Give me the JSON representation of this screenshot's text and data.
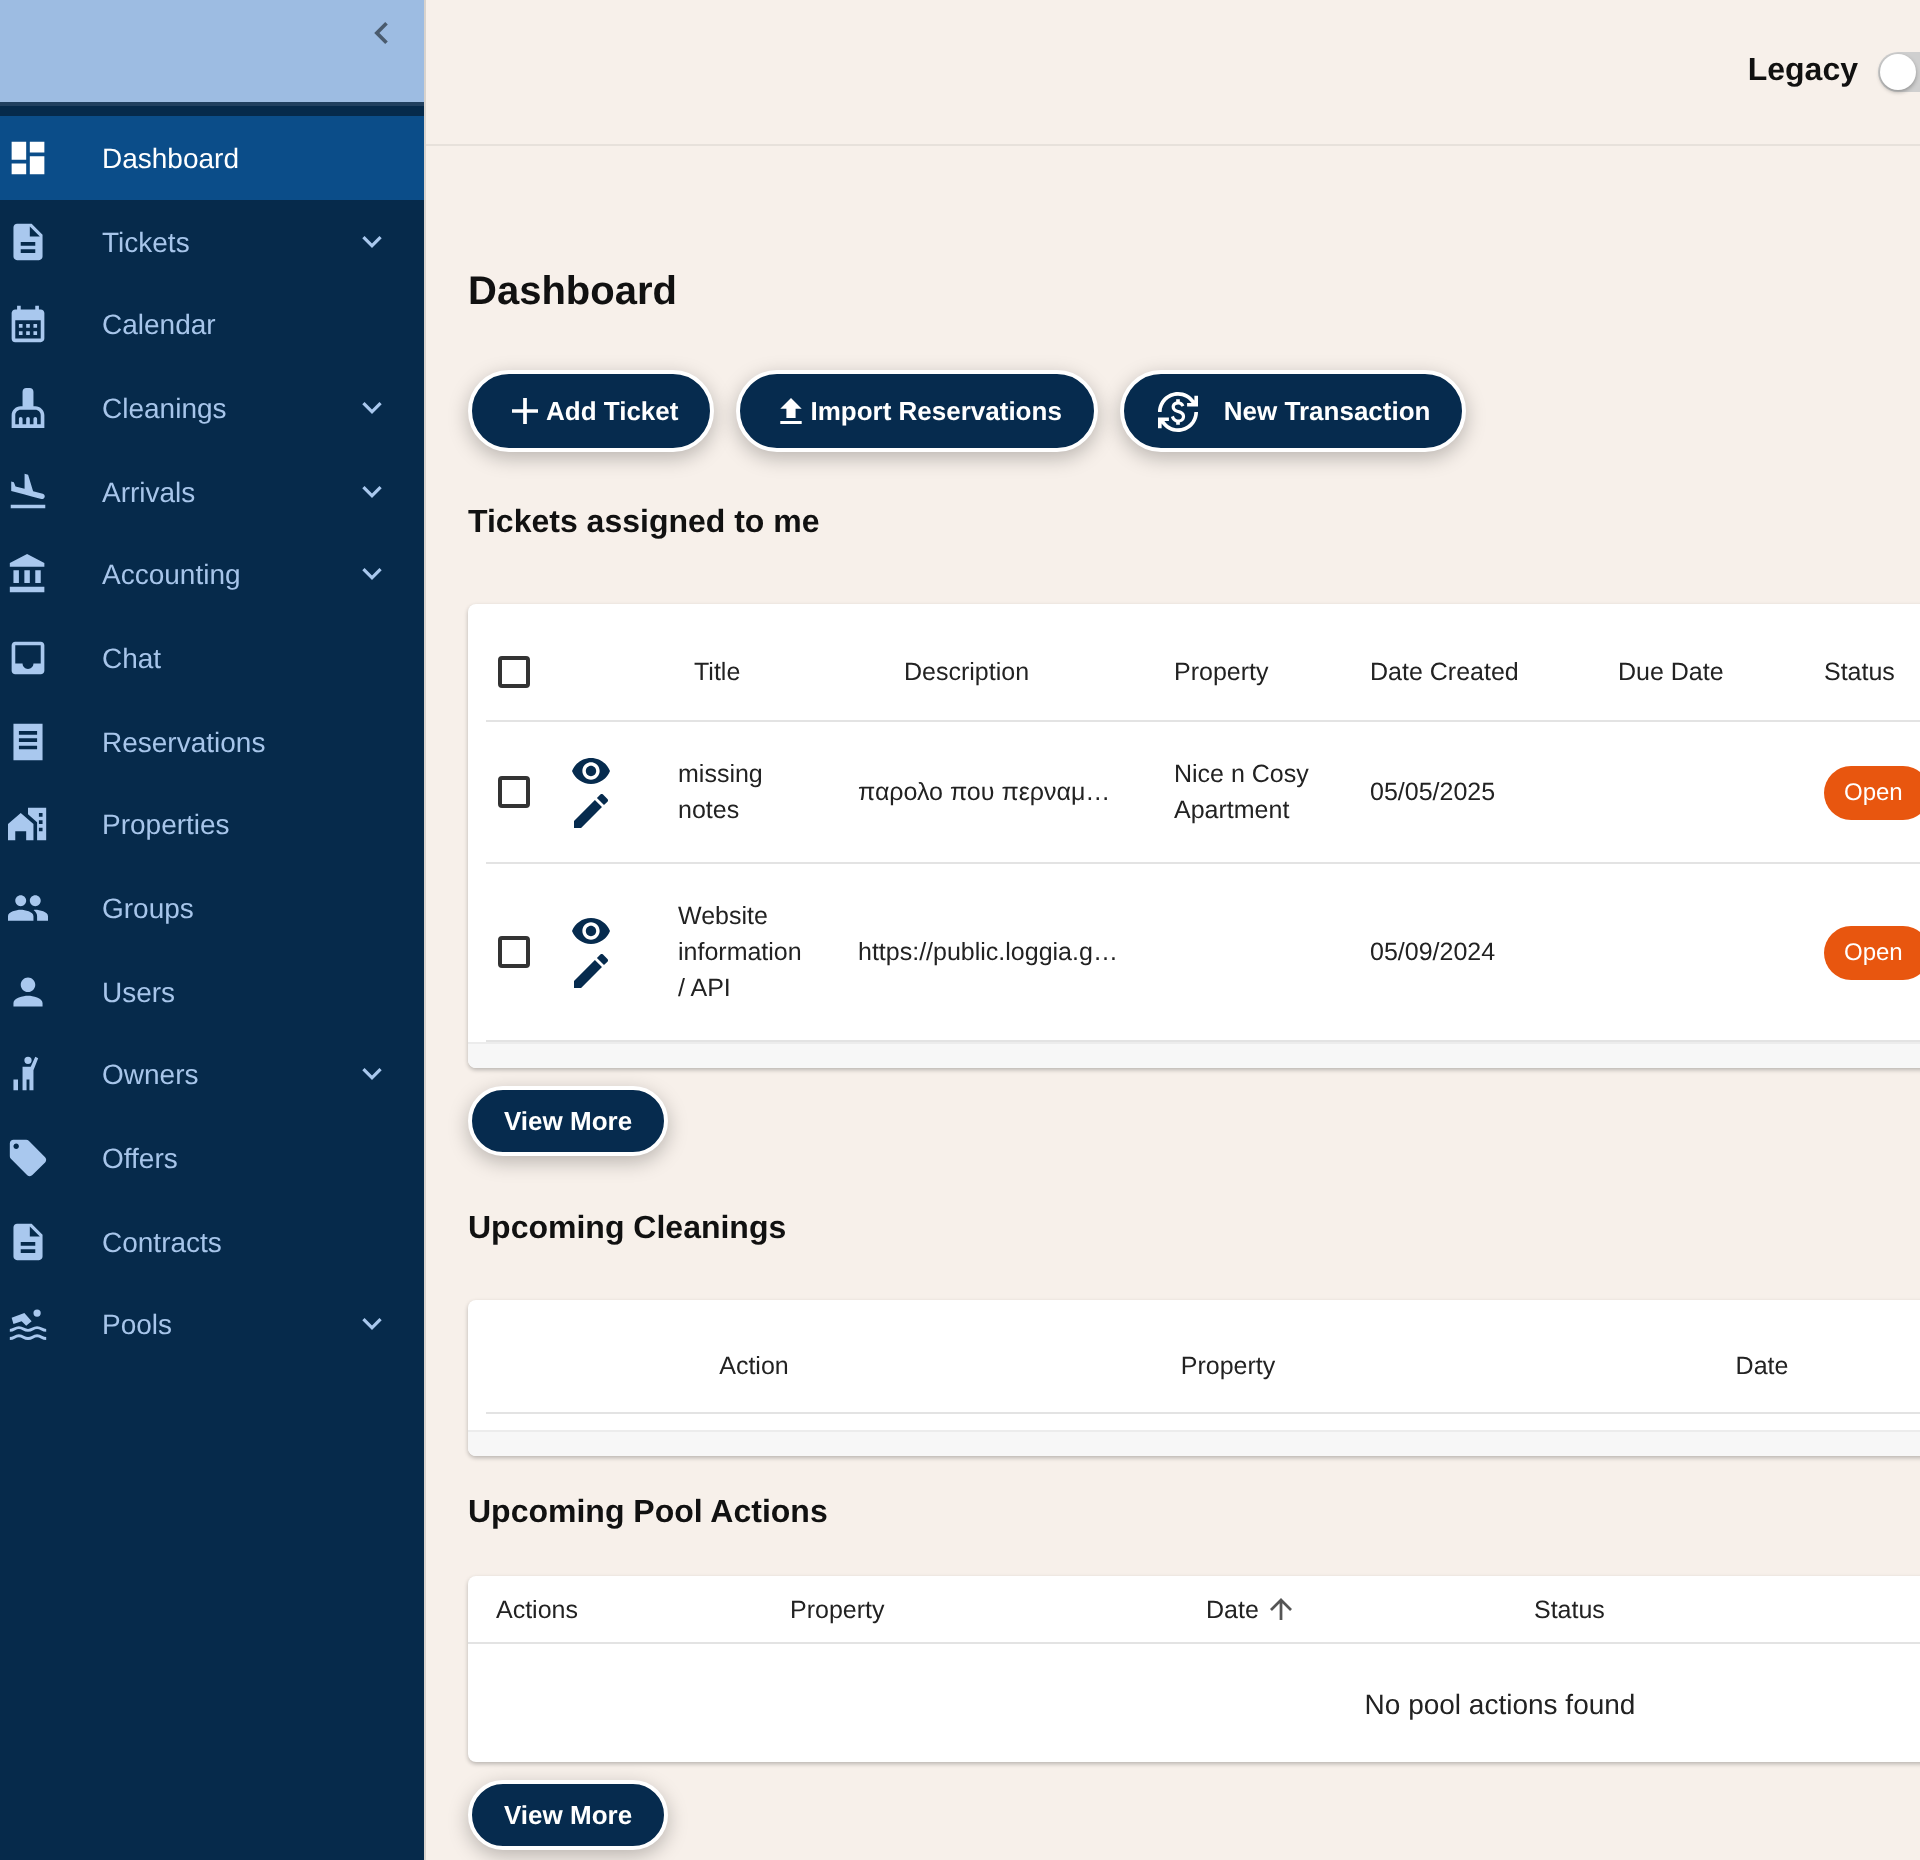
{
  "sidebar": {
    "items": [
      {
        "label": "Dashboard",
        "kind": "link",
        "selected": true
      },
      {
        "label": "Tickets",
        "kind": "group",
        "selected": false
      },
      {
        "label": "Calendar",
        "kind": "link",
        "selected": false
      },
      {
        "label": "Cleanings",
        "kind": "group",
        "selected": false
      },
      {
        "label": "Arrivals",
        "kind": "group",
        "selected": false
      },
      {
        "label": "Accounting",
        "kind": "group",
        "selected": false
      },
      {
        "label": "Chat",
        "kind": "link",
        "selected": false
      },
      {
        "label": "Reservations",
        "kind": "link",
        "selected": false
      },
      {
        "label": "Properties",
        "kind": "link",
        "selected": false
      },
      {
        "label": "Groups",
        "kind": "link",
        "selected": false
      },
      {
        "label": "Users",
        "kind": "link",
        "selected": false
      },
      {
        "label": "Owners",
        "kind": "group",
        "selected": false
      },
      {
        "label": "Offers",
        "kind": "link",
        "selected": false
      },
      {
        "label": "Contracts",
        "kind": "link",
        "selected": false
      },
      {
        "label": "Pools",
        "kind": "group",
        "selected": false
      }
    ]
  },
  "header": {
    "legacy_toggle": {
      "label": "Legacy",
      "on": false
    }
  },
  "page_title": "Dashboard",
  "actions": [
    {
      "label": "Add Ticket"
    },
    {
      "label": "Import Reservations"
    },
    {
      "label": "New Transaction"
    }
  ],
  "tickets": {
    "title": "Tickets assigned to me",
    "select_all_checked": false,
    "columns": [
      "Title",
      "Description",
      "Property",
      "Date Created",
      "Due Date",
      "Status"
    ],
    "rows": [
      {
        "checked": false,
        "title": "missing notes",
        "description": "παρολο που περναμ…",
        "property": "Nice n Cosy Apartment",
        "date_created": "05/05/2025",
        "status": "Open"
      },
      {
        "checked": false,
        "title": "Website information / API",
        "description": "https://public.loggia.g…",
        "date_created": "05/09/2024",
        "status": "Open"
      }
    ],
    "view_more": "View More"
  },
  "cleanings": {
    "title": "Upcoming Cleanings",
    "columns": [
      "Action",
      "Property",
      "Date"
    ]
  },
  "pool_actions": {
    "title": "Upcoming Pool Actions",
    "columns": [
      {
        "label": "Actions",
        "sorted": false
      },
      {
        "label": "Property",
        "sorted": false
      },
      {
        "label": "Date",
        "sorted": true
      },
      {
        "label": "Status",
        "sorted": false
      }
    ],
    "empty_message": "No pool actions found",
    "view_more": "View More"
  }
}
